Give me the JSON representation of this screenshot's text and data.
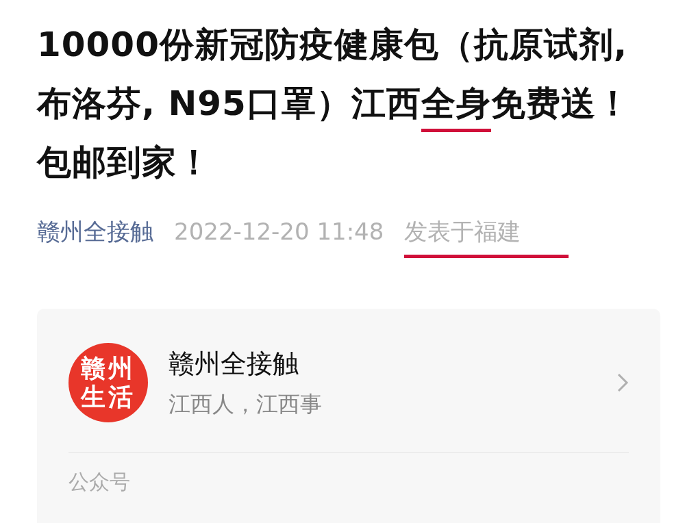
{
  "title": [
    {
      "text": "10000份新冠防疫健康包（抗原试剂, 布洛芬, N95口罩）江西",
      "underlined": false
    },
    {
      "text": "全",
      "underlined": true
    },
    {
      "text": "身",
      "underlined": true
    },
    {
      "text": "免费送！包邮到家！",
      "underlined": false
    }
  ],
  "meta": {
    "author": "赣州全接触",
    "date": "2022-12-20 11:48",
    "location": "发表于福建",
    "location_underlined": true
  },
  "account": {
    "logo_lines": [
      "赣州",
      "生活"
    ],
    "name": "赣州全接触",
    "description": "江西人，江西事",
    "footer": "公众号"
  }
}
